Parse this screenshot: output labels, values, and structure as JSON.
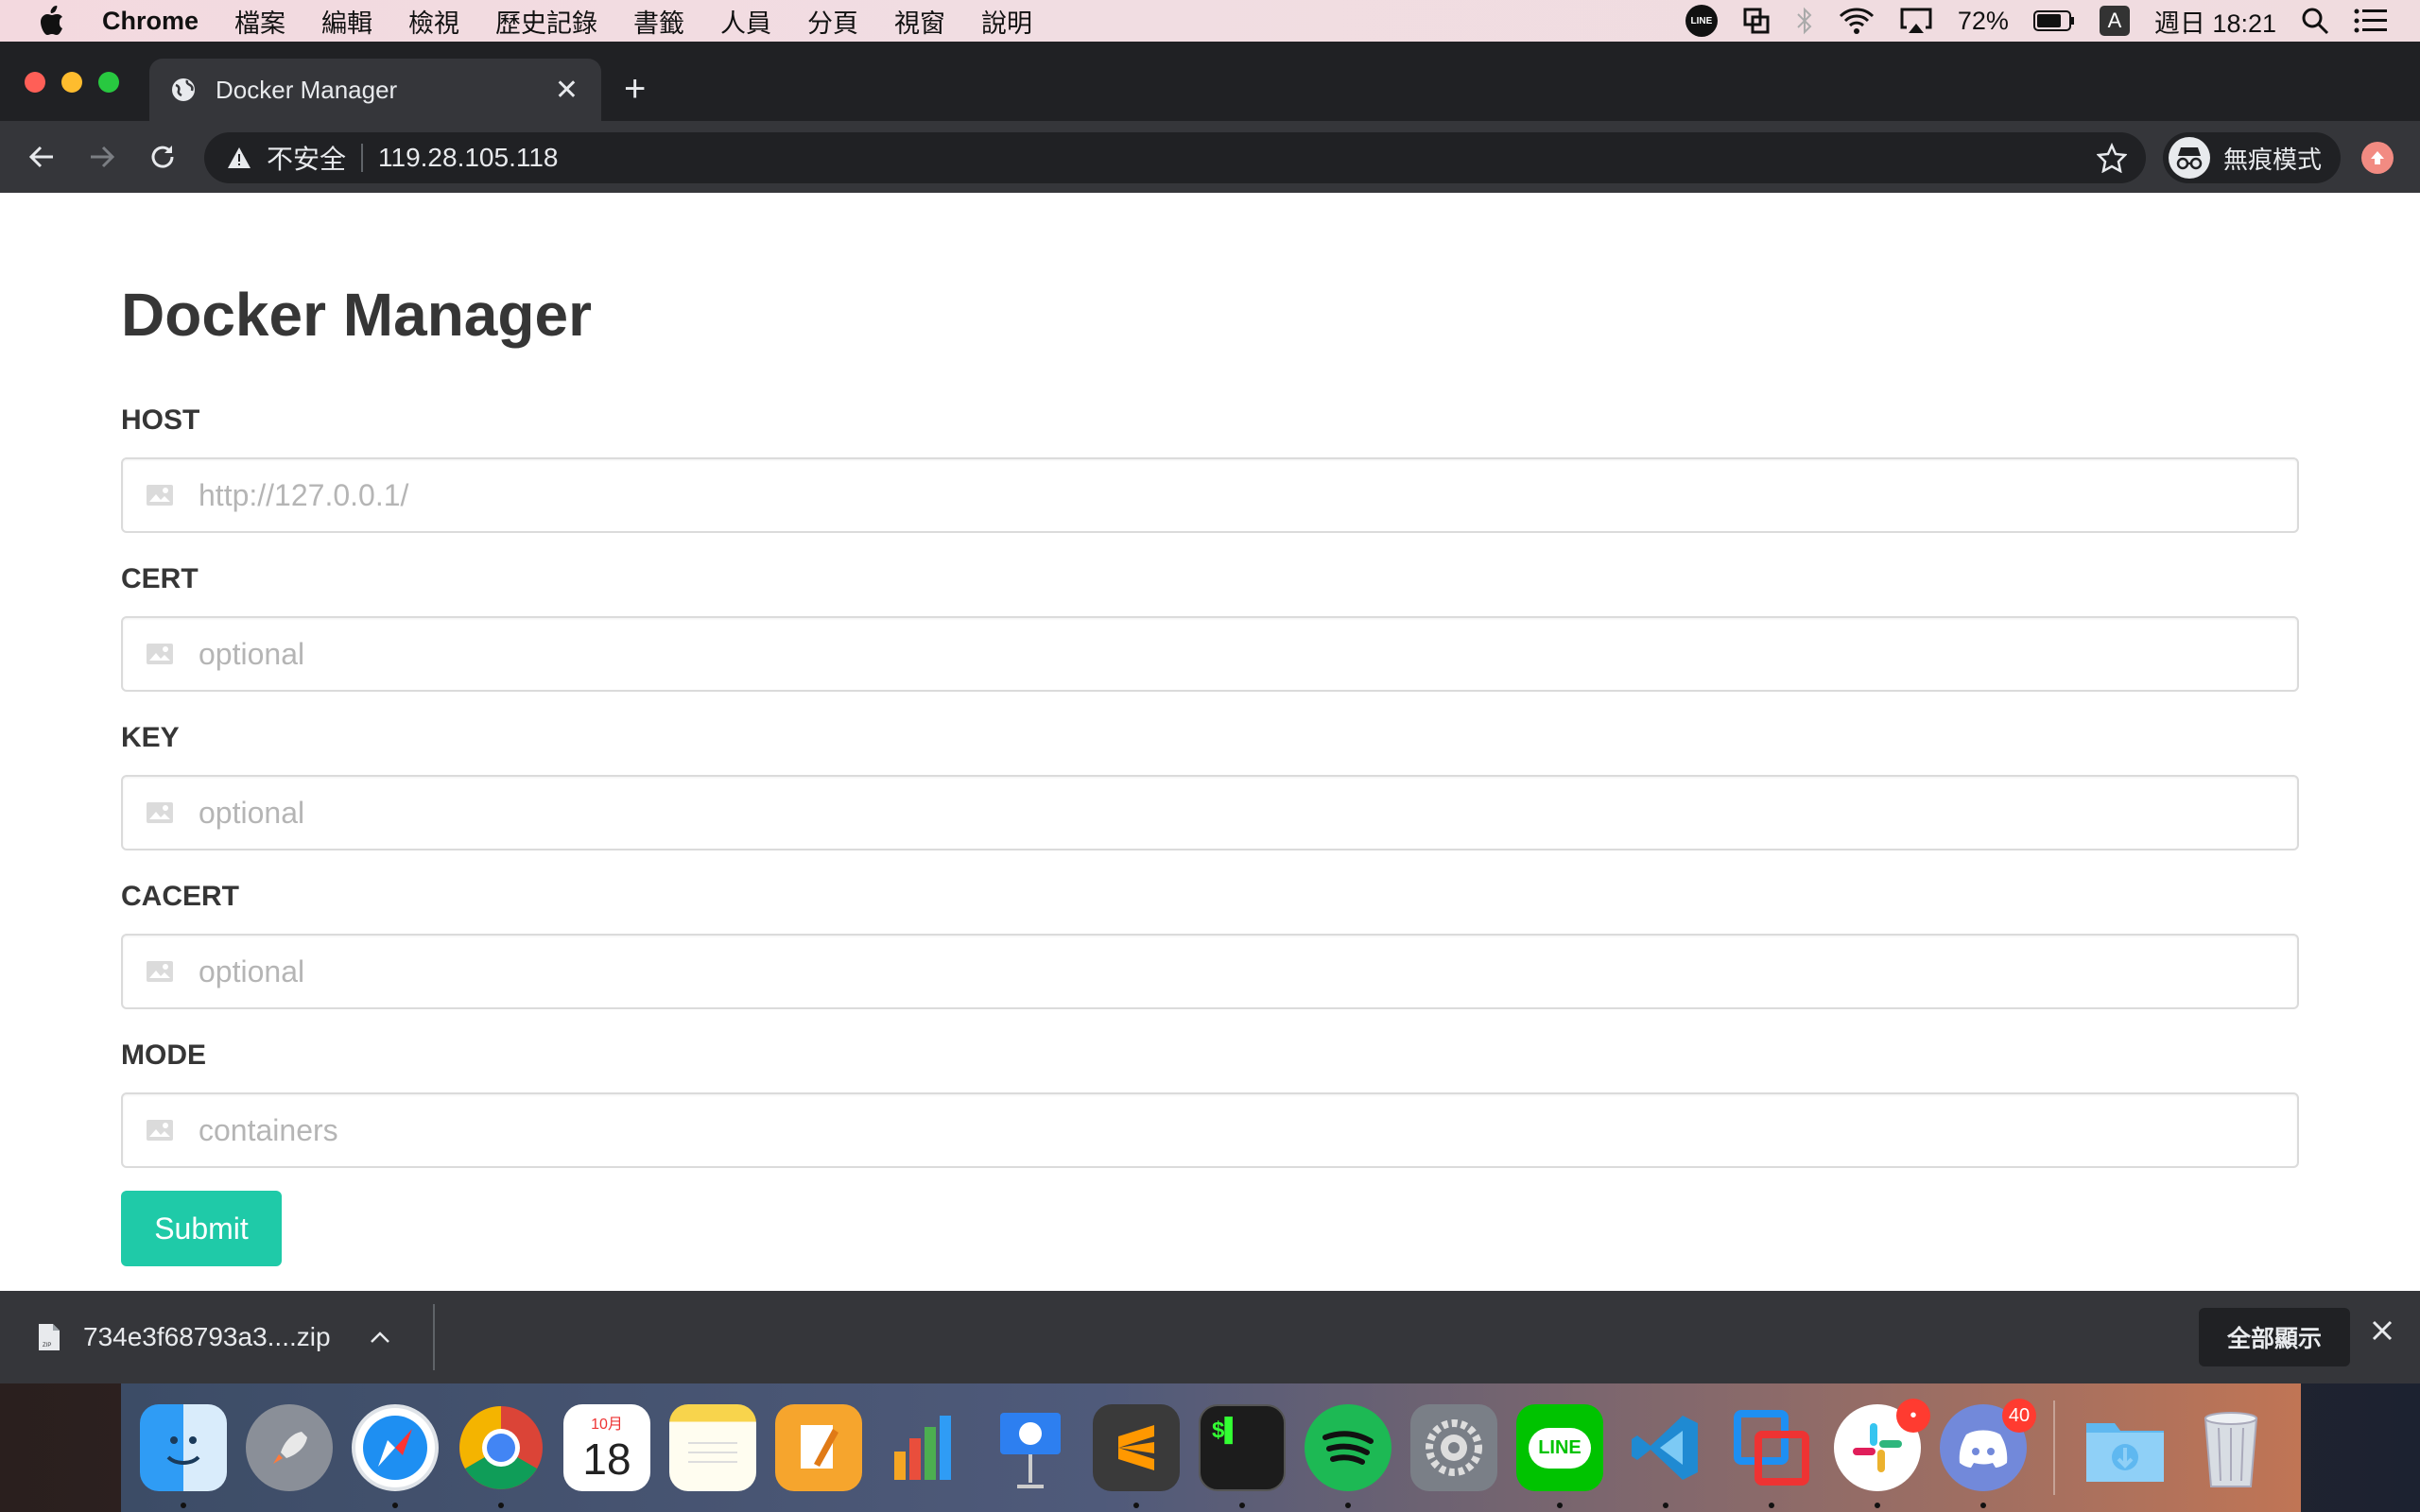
{
  "menubar": {
    "app_name": "Chrome",
    "items": [
      "檔案",
      "編輯",
      "檢視",
      "歷史記錄",
      "書籤",
      "人員",
      "分頁",
      "視窗",
      "說明"
    ],
    "battery": "72%",
    "input_method": "A",
    "clock": "週日 18:21"
  },
  "tab": {
    "title": "Docker Manager"
  },
  "toolbar": {
    "security_label": "不安全",
    "url": "119.28.105.118",
    "profile_label": "無痕模式"
  },
  "page": {
    "title": "Docker Manager",
    "fields": [
      {
        "label": "HOST",
        "placeholder": "http://127.0.0.1/",
        "value": ""
      },
      {
        "label": "CERT",
        "placeholder": "optional",
        "value": ""
      },
      {
        "label": "KEY",
        "placeholder": "optional",
        "value": ""
      },
      {
        "label": "CACERT",
        "placeholder": "optional",
        "value": ""
      },
      {
        "label": "MODE",
        "placeholder": "containers",
        "value": ""
      }
    ],
    "submit_label": "Submit"
  },
  "downloads": {
    "filename": "734e3f68793a3....zip",
    "show_all_label": "全部顯示"
  },
  "dock": {
    "calendar_month": "10月",
    "calendar_day": "18",
    "slack_badge": "•",
    "discord_badge": "40",
    "line_label": "LINE"
  },
  "colors": {
    "submit": "#1fcaa8",
    "chrome_dark": "#202124",
    "chrome_toolbar": "#35363a"
  }
}
